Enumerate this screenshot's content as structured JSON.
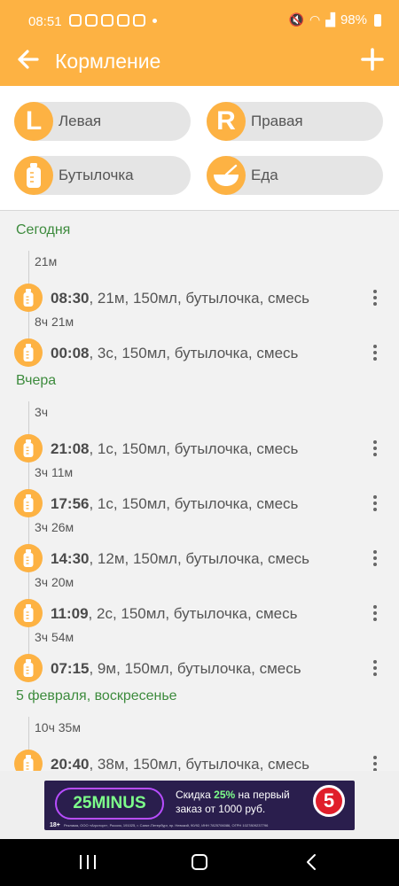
{
  "status_bar": {
    "time": "08:51",
    "battery": "98%"
  },
  "app_bar": {
    "title": "Кормление"
  },
  "feed_types": [
    {
      "badge": "L",
      "label": "Левая",
      "icon": "left-breast-icon"
    },
    {
      "badge": "R",
      "label": "Правая",
      "icon": "right-breast-icon"
    },
    {
      "badge": "",
      "label": "Бутылочка",
      "icon": "bottle-icon"
    },
    {
      "badge": "",
      "label": "Еда",
      "icon": "food-bowl-icon"
    }
  ],
  "timeline": [
    {
      "day": "Сегодня",
      "entries": [
        {
          "gap": "21м",
          "time": "08:30",
          "details": ", 21м, 150мл, бутылочка, смесь"
        },
        {
          "gap": "8ч 21м",
          "time": "00:08",
          "details": ", 3с, 150мл, бутылочка, смесь"
        }
      ]
    },
    {
      "day": "Вчера",
      "entries": [
        {
          "gap": "3ч",
          "time": "21:08",
          "details": ", 1с, 150мл, бутылочка, смесь"
        },
        {
          "gap": "3ч 11м",
          "time": "17:56",
          "details": ", 1с, 150мл, бутылочка, смесь"
        },
        {
          "gap": "3ч 26м",
          "time": "14:30",
          "details": ", 12м, 150мл, бутылочка, смесь"
        },
        {
          "gap": "3ч 20м",
          "time": "11:09",
          "details": ", 2с, 150мл, бутылочка, смесь"
        },
        {
          "gap": "3ч 54м",
          "time": "07:15",
          "details": ", 9м, 150мл, бутылочка, смесь"
        }
      ]
    },
    {
      "day": "5 февраля, воскресенье",
      "entries": [
        {
          "gap": "10ч 35м",
          "time": "20:40",
          "details": ", 38м, 150мл, бутылочка, смесь"
        }
      ]
    }
  ],
  "ad": {
    "brand": "25MINUS",
    "line1_prefix": "Скидка ",
    "line1_pct": "25%",
    "line1_suffix": " на первый",
    "line2": "заказ от 1000 руб.",
    "logo": "5",
    "age": "18+",
    "legal": "Реклама, ООО «Агроторг», Россия, 191025, г. Санкт-Петербург, пр. Невский, 90/92, ИНН 7825706086, ОГРН 1027809237796"
  },
  "colors": {
    "accent": "#fdb243",
    "day_header": "#3d8b3d",
    "background": "#f2f2f2"
  }
}
